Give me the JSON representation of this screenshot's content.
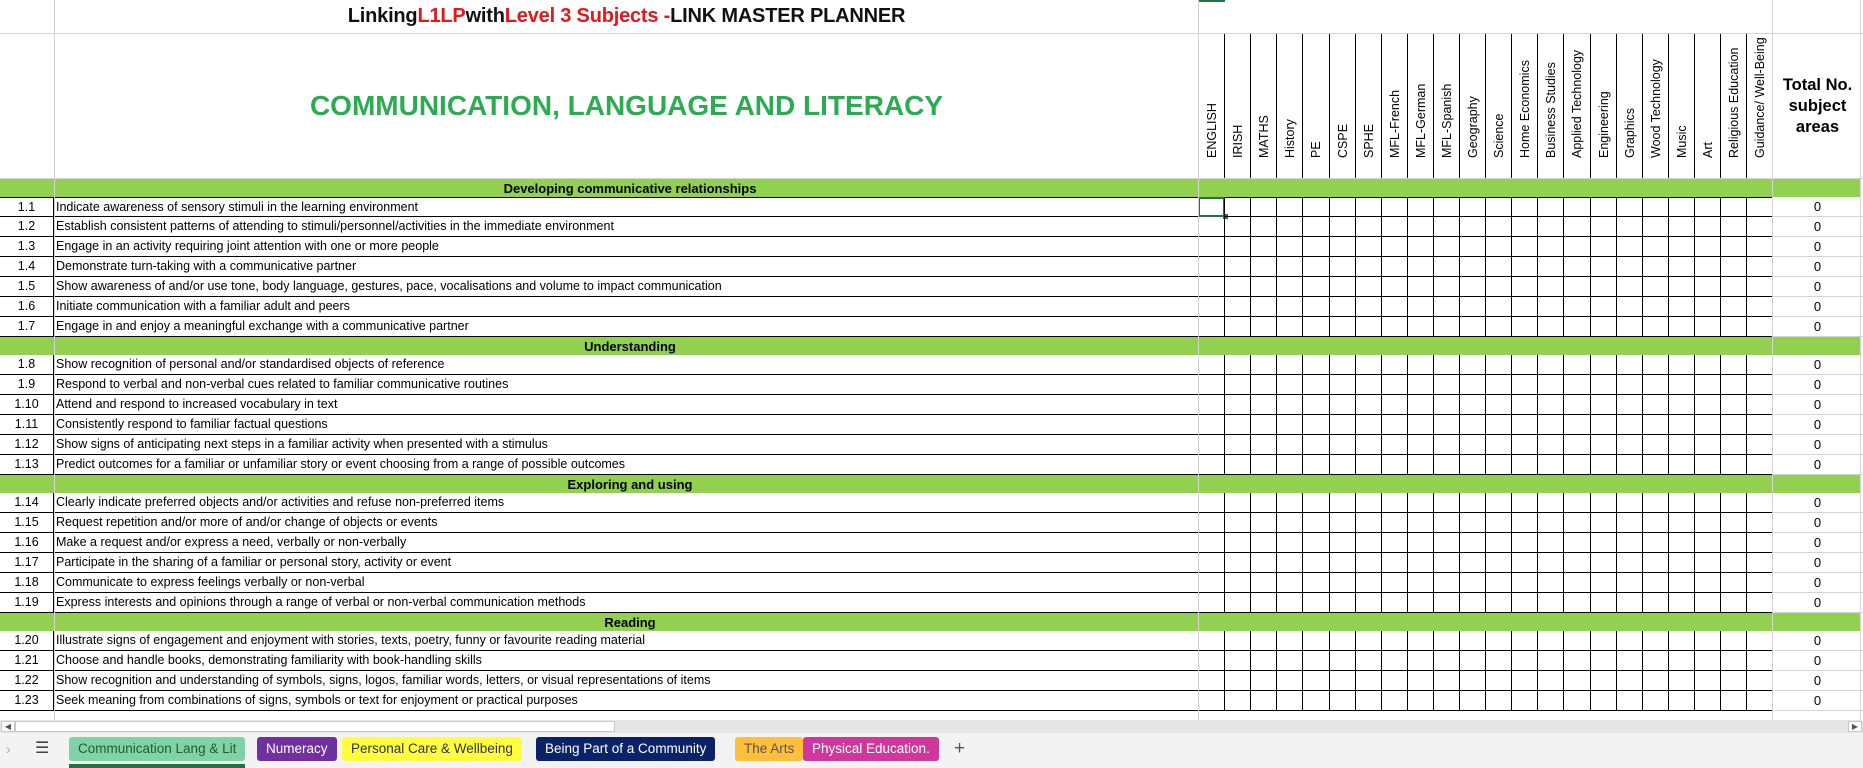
{
  "title": {
    "part1": "Linking ",
    "part2": "L1LP",
    "part3": " with ",
    "part4": "Level 3 Subjects - ",
    "part5": " LINK MASTER PLANNER"
  },
  "heading": "COMMUNICATION, LANGUAGE AND LITERACY",
  "subjects": [
    "ENGLISH",
    "IRISH",
    "MATHS",
    "History",
    "PE",
    "CSPE",
    "SPHE",
    "MFL-French",
    "MFL-German",
    "MFL-Spanish",
    "Geography",
    "Science",
    "Home Economics",
    "Business Studies",
    "Applied Technology",
    "Engineering",
    "Graphics",
    "Wood Technology",
    "Music",
    "Art",
    "Religious Education",
    "Guidance/ Well-Being"
  ],
  "total_header": "Total No. subject areas",
  "sections": [
    {
      "title": "Developing communicative relationships",
      "rows": [
        {
          "num": "1.1",
          "desc": "Indicate awareness of sensory stimuli in the learning environment",
          "total": "0"
        },
        {
          "num": "1.2",
          "desc": "Establish consistent patterns of attending to stimuli/personnel/activities in the immediate environment",
          "total": "0"
        },
        {
          "num": "1.3",
          "desc": "Engage in an activity requiring joint attention with one or more people",
          "total": "0"
        },
        {
          "num": "1.4",
          "desc": "Demonstrate turn-taking with a communicative partner",
          "total": "0"
        },
        {
          "num": "1.5",
          "desc": "Show awareness of and/or use tone, body language, gestures, pace, vocalisations and volume to impact communication",
          "total": "0"
        },
        {
          "num": "1.6",
          "desc": "Initiate communication with a familiar adult and peers",
          "total": "0"
        },
        {
          "num": "1.7",
          "desc": "Engage in and enjoy a meaningful exchange with a communicative partner",
          "total": "0"
        }
      ]
    },
    {
      "title": "Understanding",
      "rows": [
        {
          "num": "1.8",
          "desc": "Show recognition of personal and/or standardised objects of reference",
          "total": "0"
        },
        {
          "num": "1.9",
          "desc": "Respond to verbal and non-verbal cues related to familiar communicative routines",
          "total": "0"
        },
        {
          "num": "1.10",
          "desc": "Attend and respond to increased vocabulary in text",
          "total": "0"
        },
        {
          "num": "1.11",
          "desc": "Consistently respond to familiar factual questions",
          "total": "0"
        },
        {
          "num": "1.12",
          "desc": "Show signs of anticipating next steps in a familiar activity when presented with a stimulus",
          "total": "0"
        },
        {
          "num": "1.13",
          "desc": "Predict outcomes for a familiar or unfamiliar story or event choosing from a range of possible outcomes",
          "total": "0"
        }
      ]
    },
    {
      "title": "Exploring and using",
      "rows": [
        {
          "num": "1.14",
          "desc": "Clearly indicate preferred objects and/or activities and refuse non-preferred items",
          "total": "0"
        },
        {
          "num": "1.15",
          "desc": "Request repetition and/or more of and/or change of objects or events",
          "total": "0"
        },
        {
          "num": "1.16",
          "desc": "Make a request and/or express a need, verbally or non-verbally",
          "total": "0"
        },
        {
          "num": "1.17",
          "desc": "Participate in the sharing of a familiar or personal story, activity or event",
          "total": "0"
        },
        {
          "num": "1.18",
          "desc": "Communicate to express feelings verbally or non-verbal",
          "total": "0"
        },
        {
          "num": "1.19",
          "desc": "Express interests and opinions through a range of verbal or non-verbal communication methods",
          "total": "0"
        }
      ]
    },
    {
      "title": "Reading",
      "rows": [
        {
          "num": "1.20",
          "desc": "Illustrate signs of engagement and enjoyment with stories, texts, poetry, funny or favourite reading material",
          "total": "0"
        },
        {
          "num": "1.21",
          "desc": "Choose and handle books, demonstrating familiarity with book-handling skills",
          "total": "0"
        },
        {
          "num": "1.22",
          "desc": "Show recognition and understanding of symbols, signs, logos, familiar words, letters, or visual representations of items",
          "total": "0"
        },
        {
          "num": "1.23",
          "desc": "Seek meaning from combinations of signs, symbols or text for enjoyment or practical purposes",
          "total": "0"
        }
      ]
    }
  ],
  "tabs": [
    {
      "label": "Communication Lang & Lit",
      "bg": "#7fd4a6",
      "fg": "#1f5c3a",
      "active": true
    },
    {
      "label": "Numeracy",
      "bg": "#7030a0",
      "fg": "#ffffff",
      "active": false
    },
    {
      "label": "Personal Care & Wellbeing",
      "bg": "#ffff40",
      "fg": "#333333",
      "active": false
    },
    {
      "label": "Being Part of a Community",
      "bg": "#0b2366",
      "fg": "#ffffff",
      "active": false
    },
    {
      "label": "The Arts",
      "bg": "#ffbf3a",
      "fg": "#555555",
      "active": false
    },
    {
      "label": "Physical Education.",
      "bg": "#d0379d",
      "fg": "#ffffff",
      "active": false
    }
  ],
  "tabbar": {
    "add_label": "+",
    "menu_label": "☰",
    "nav_label": "›"
  },
  "colors": {
    "section_green": "#92d050",
    "heading_green": "#2bab52",
    "title_red": "#e8151b",
    "selection": "#217346"
  }
}
